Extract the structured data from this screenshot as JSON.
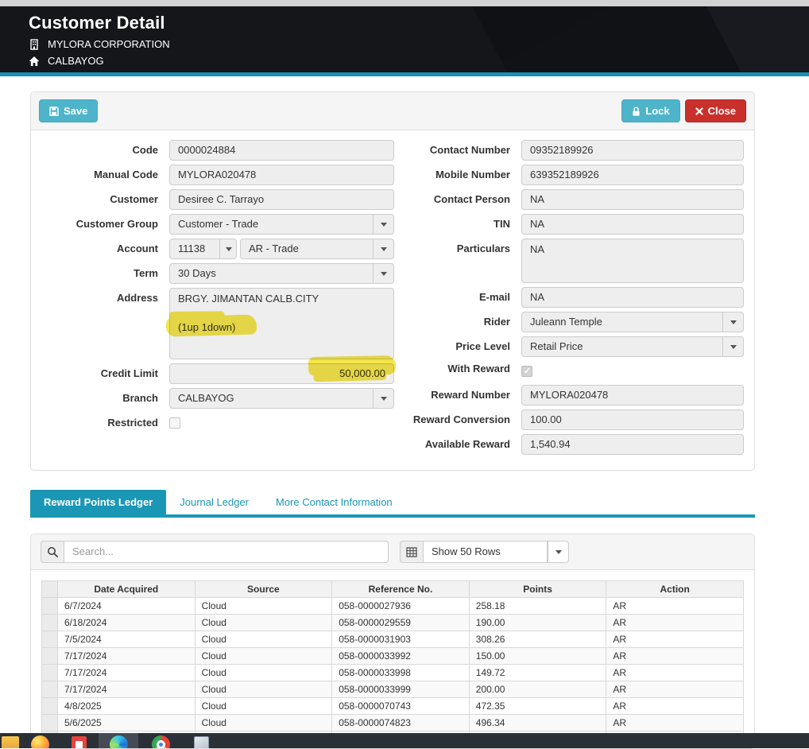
{
  "colors": {
    "teal_button": "#4db4ca",
    "tab_active_teal": "#1a97b5",
    "close_red": "#c9302c",
    "header_accent_bar": "#1691b4",
    "highlighter_yellow": "#f2df1d"
  },
  "header": {
    "title": "Customer Detail",
    "company": "MYLORA CORPORATION",
    "location": "CALBAYOG"
  },
  "toolbar": {
    "save": "Save",
    "lock": "Lock",
    "close": "Close"
  },
  "form": {
    "code": {
      "label": "Code",
      "value": "0000024884"
    },
    "manual_code": {
      "label": "Manual Code",
      "value": "MYLORA020478"
    },
    "customer": {
      "label": "Customer",
      "value": "Desiree C. Tarrayo"
    },
    "customer_group": {
      "label": "Customer Group",
      "value": "Customer - Trade"
    },
    "account": {
      "label": "Account",
      "code": "11138",
      "name": "AR - Trade"
    },
    "term": {
      "label": "Term",
      "value": "30 Days"
    },
    "address": {
      "label": "Address",
      "line1": "BRGY. JIMANTAN CALB.CITY",
      "line3": "(1up 1down)"
    },
    "credit_limit": {
      "label": "Credit Limit",
      "value": "50,000.00"
    },
    "branch": {
      "label": "Branch",
      "value": "CALBAYOG"
    },
    "restricted": {
      "label": "Restricted",
      "checked": false
    },
    "contact_number": {
      "label": "Contact Number",
      "value": "09352189926"
    },
    "mobile_number": {
      "label": "Mobile Number",
      "value": "639352189926"
    },
    "contact_person": {
      "label": "Contact Person",
      "value": "NA"
    },
    "tin": {
      "label": "TIN",
      "value": "NA"
    },
    "particulars": {
      "label": "Particulars",
      "value": "NA"
    },
    "email": {
      "label": "E-mail",
      "value": "NA"
    },
    "rider": {
      "label": "Rider",
      "value": "Juleann Temple"
    },
    "price_level": {
      "label": "Price Level",
      "value": "Retail Price"
    },
    "with_reward": {
      "label": "With Reward",
      "checked": true
    },
    "reward_number": {
      "label": "Reward Number",
      "value": "MYLORA020478"
    },
    "reward_conversion": {
      "label": "Reward Conversion",
      "value": "100.00"
    },
    "available_reward": {
      "label": "Available Reward",
      "value": "1,540.94"
    }
  },
  "tabs": [
    {
      "label": "Reward Points Ledger",
      "active": true
    },
    {
      "label": "Journal Ledger",
      "active": false
    },
    {
      "label": "More Contact Information",
      "active": false
    }
  ],
  "ledger_toolbar": {
    "search_placeholder": "Search...",
    "rows_selector": "Show 50 Rows"
  },
  "ledger": {
    "columns": [
      "Date Acquired",
      "Source",
      "Reference No.",
      "Points",
      "Action"
    ],
    "rows": [
      [
        "6/7/2024",
        "Cloud",
        "058-0000027936",
        "258.18",
        "AR"
      ],
      [
        "6/18/2024",
        "Cloud",
        "058-0000029559",
        "190.00",
        "AR"
      ],
      [
        "7/5/2024",
        "Cloud",
        "058-0000031903",
        "308.26",
        "AR"
      ],
      [
        "7/17/2024",
        "Cloud",
        "058-0000033992",
        "150.00",
        "AR"
      ],
      [
        "7/17/2024",
        "Cloud",
        "058-0000033998",
        "149.72",
        "AR"
      ],
      [
        "7/17/2024",
        "Cloud",
        "058-0000033999",
        "200.00",
        "AR"
      ],
      [
        "4/8/2025",
        "Cloud",
        "058-0000070743",
        "472.35",
        "AR"
      ],
      [
        "5/6/2025",
        "Cloud",
        "058-0000074823",
        "496.34",
        "AR"
      ],
      [
        "",
        "",
        "",
        "",
        ""
      ]
    ]
  },
  "taskbar": {
    "icons": [
      "folder-icon",
      "firefox-icon",
      "red-app-icon",
      "edge-icon",
      "chrome-icon",
      "file-icon"
    ]
  }
}
